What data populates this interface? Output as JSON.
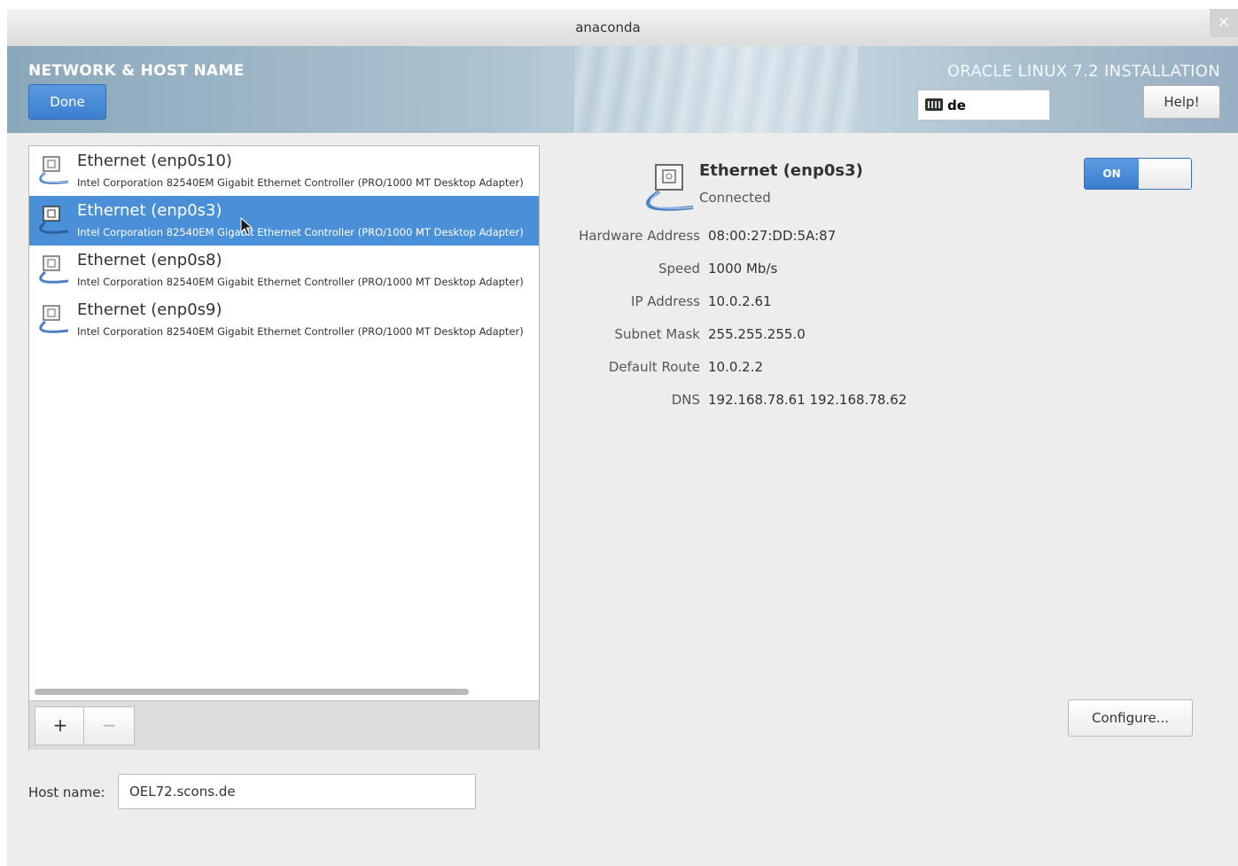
{
  "window": {
    "title": "anaconda",
    "close_glyph": "×"
  },
  "header": {
    "spoke_title": "NETWORK & HOST NAME",
    "done_label": "Done",
    "product_title": "ORACLE LINUX 7.2 INSTALLATION",
    "keyboard_layout": "de",
    "help_label": "Help!"
  },
  "devices": [
    {
      "name": "Ethernet (enp0s10)",
      "description": "Intel Corporation 82540EM Gigabit Ethernet Controller (PRO/1000 MT Desktop Adapter)",
      "selected": false
    },
    {
      "name": "Ethernet (enp0s3)",
      "description": "Intel Corporation 82540EM Gigabit Ethernet Controller (PRO/1000 MT Desktop Adapter)",
      "selected": true
    },
    {
      "name": "Ethernet (enp0s8)",
      "description": "Intel Corporation 82540EM Gigabit Ethernet Controller (PRO/1000 MT Desktop Adapter)",
      "selected": false
    },
    {
      "name": "Ethernet (enp0s9)",
      "description": "Intel Corporation 82540EM Gigabit Ethernet Controller (PRO/1000 MT Desktop Adapter)",
      "selected": false
    }
  ],
  "list_toolbar": {
    "add_label": "+",
    "remove_label": "−"
  },
  "detail": {
    "name": "Ethernet (enp0s3)",
    "status": "Connected",
    "toggle_label": "ON",
    "toggle_state": "on",
    "fields": [
      {
        "label": "Hardware Address",
        "value": "08:00:27:DD:5A:87"
      },
      {
        "label": "Speed",
        "value": "1000 Mb/s"
      },
      {
        "label": "IP Address",
        "value": "10.0.2.61"
      },
      {
        "label": "Subnet Mask",
        "value": "255.255.255.0"
      },
      {
        "label": "Default Route",
        "value": "10.0.2.2"
      },
      {
        "label": "DNS",
        "value": "192.168.78.61 192.168.78.62"
      }
    ],
    "configure_label": "Configure..."
  },
  "hostname": {
    "label": "Host name:",
    "value": "OEL72.scons.de"
  },
  "colors": {
    "accent": "#4a90d9",
    "done_button": "#3b7fd0",
    "background": "#ededed"
  }
}
